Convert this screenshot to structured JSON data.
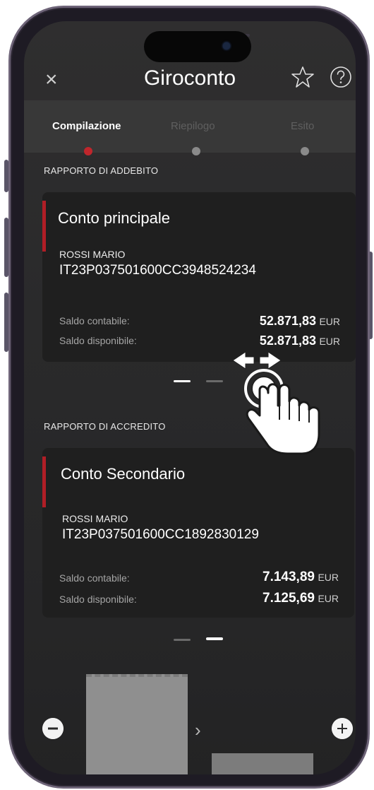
{
  "header": {
    "title": "Giroconto",
    "close_icon": "close-icon",
    "star_icon": "star-icon",
    "help_icon": "help-icon"
  },
  "stepper": {
    "steps": [
      {
        "label": "Compilazione",
        "active": true
      },
      {
        "label": "Riepilogo",
        "active": false
      },
      {
        "label": "Esito",
        "active": false
      }
    ]
  },
  "debit": {
    "section_label": "RAPPORTO DI ADDEBITO",
    "card": {
      "title": "Conto principale",
      "holder": "ROSSI MARIO",
      "iban": "IT23P037501600CC3948524234",
      "accounting_label": "Saldo contabile:",
      "accounting_value": "52.871,83",
      "available_label": "Saldo disponibile:",
      "available_value": "52.871,83",
      "currency": "EUR"
    },
    "pager": {
      "pages": 2,
      "active": 1
    }
  },
  "credit": {
    "section_label": "RAPPORTO DI ACCREDITO",
    "card": {
      "title": "Conto Secondario",
      "holder": "ROSSI MARIO",
      "iban": "IT23P037501600CC1892830129",
      "accounting_label": "Saldo contabile:",
      "accounting_value": "7.143,89",
      "available_label": "Saldo disponibile:",
      "available_value": "7.125,69",
      "currency": "EUR"
    },
    "pager": {
      "pages": 2,
      "active": 2
    }
  },
  "bottom": {
    "minus_icon": "minus-icon",
    "plus_icon": "plus-icon",
    "chevron_icon": "chevron-right-icon"
  },
  "overlay": {
    "gesture_icon": "swipe-hand-icon"
  },
  "colors": {
    "accent": "#c0262c",
    "background": "#2b2b2b",
    "card": "#1f1f1f",
    "stepper_bg": "#383838"
  }
}
